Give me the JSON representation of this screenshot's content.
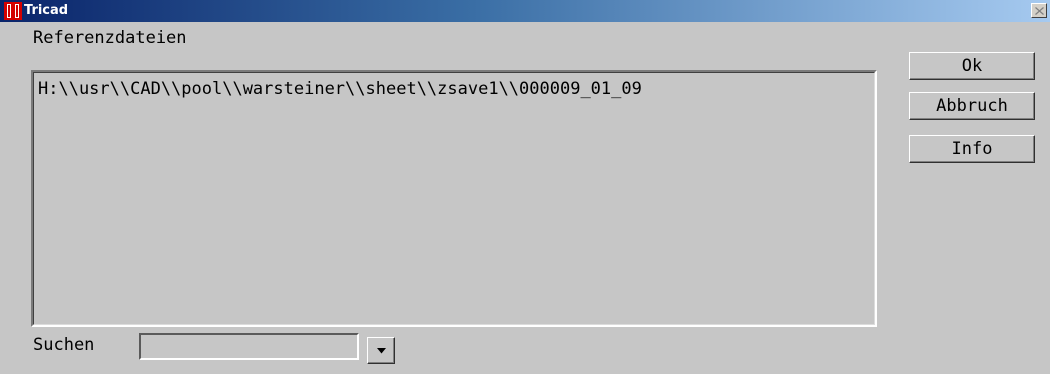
{
  "window": {
    "title": "Tricad",
    "close_icon": "close-icon",
    "app_icon": "tricad-app-icon"
  },
  "references": {
    "label": "Referenzdateien",
    "items": [
      "H:\\\\usr\\\\CAD\\\\pool\\\\warsteiner\\\\sheet\\\\zsave1\\\\000009_01_09"
    ]
  },
  "buttons": {
    "ok": "Ok",
    "cancel": "Abbruch",
    "info": "Info"
  },
  "search": {
    "label": "Suchen",
    "value": "",
    "dropdown_icon": "chevron-down-icon"
  },
  "colors": {
    "dialog_background": "#c6c6c6",
    "titlebar_start": "#0a246a",
    "titlebar_end": "#a6caf0",
    "icon_red": "#d40000"
  }
}
